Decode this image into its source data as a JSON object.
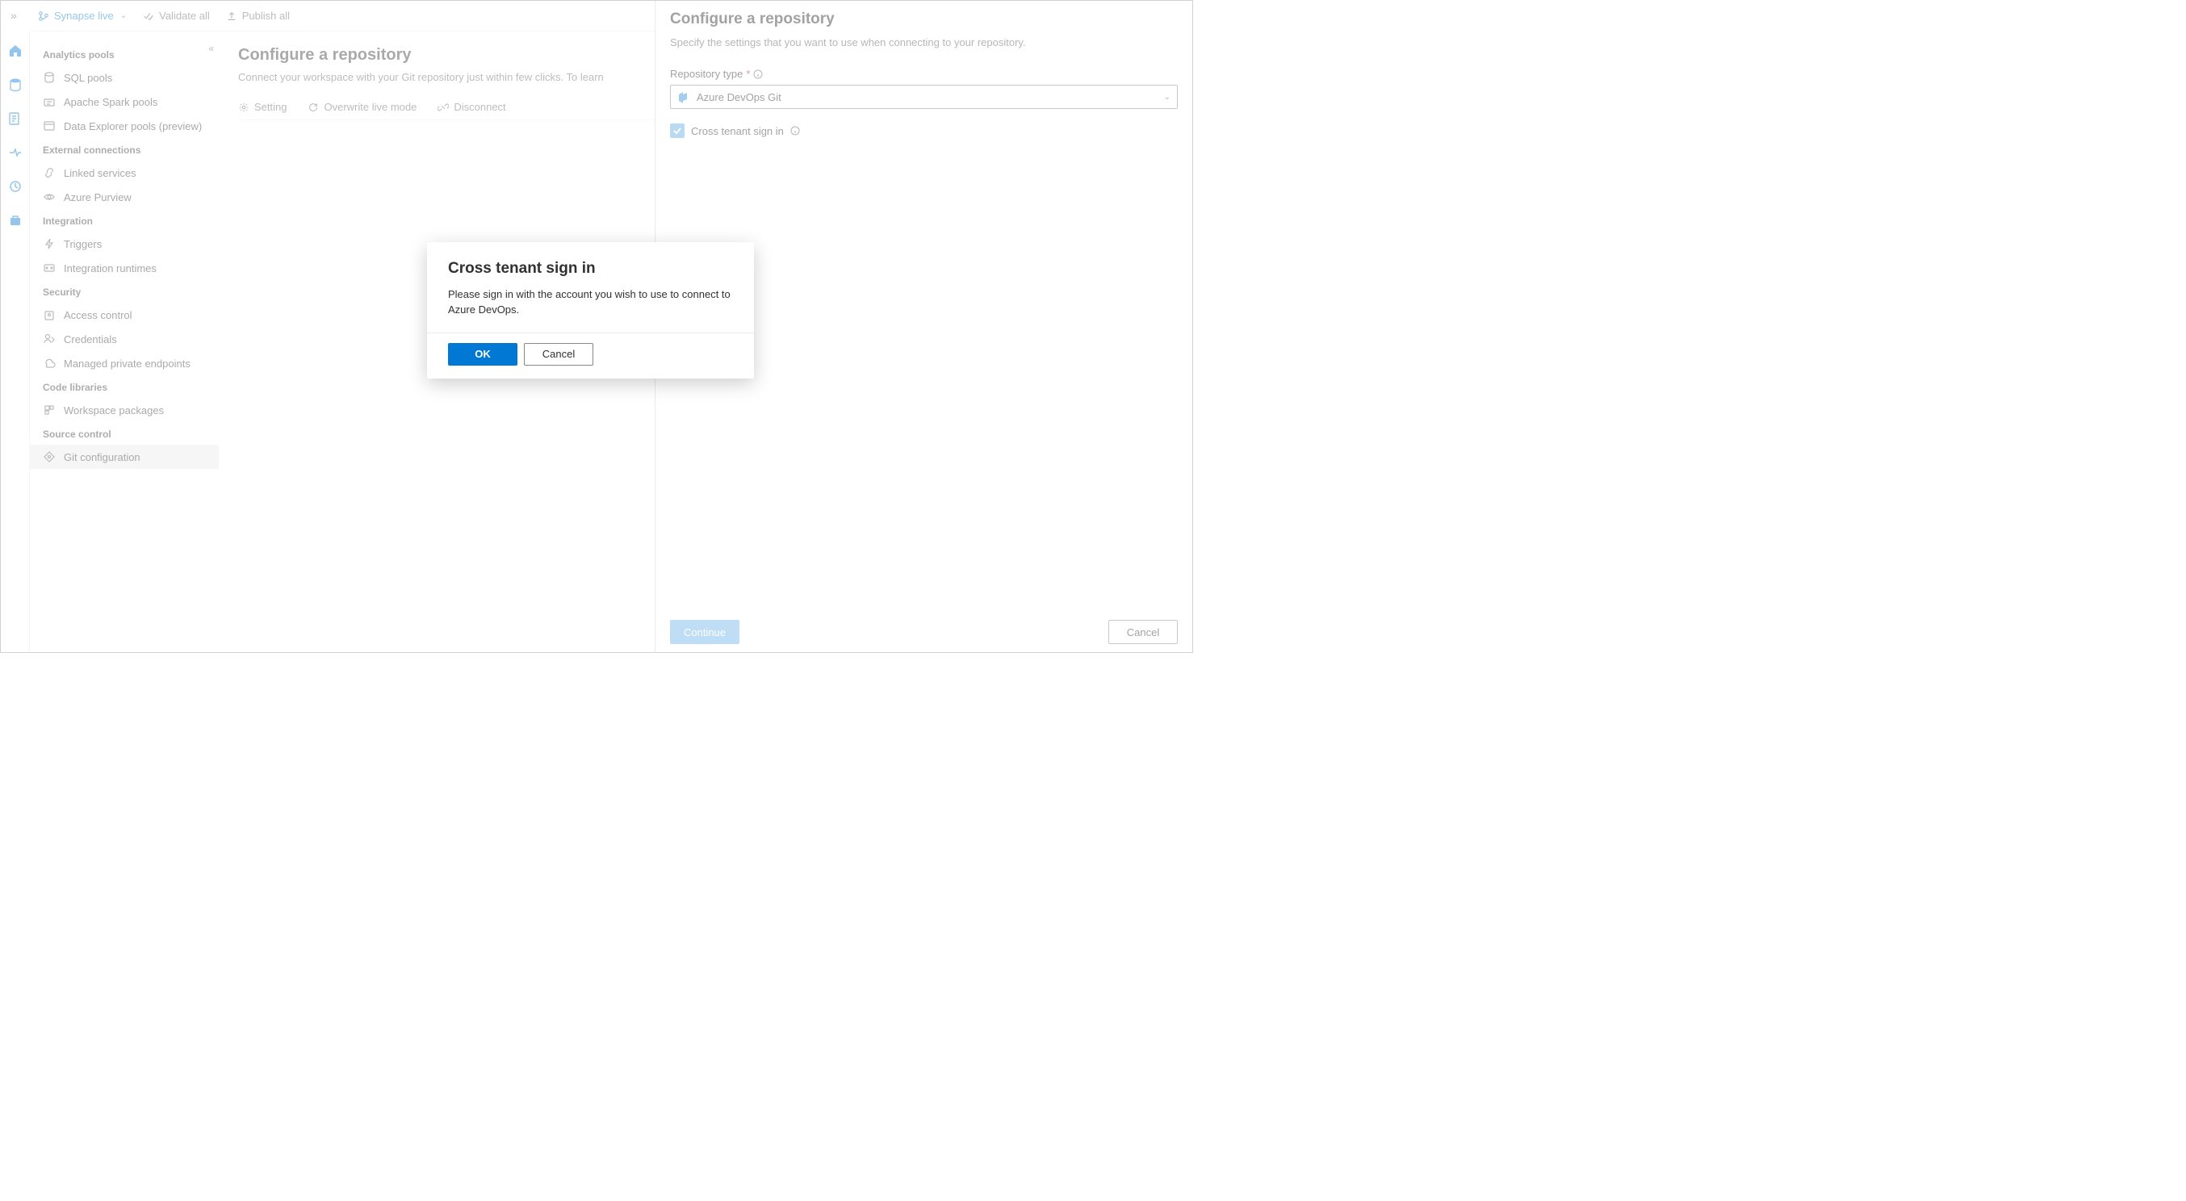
{
  "toolbar": {
    "mode_label": "Synapse live",
    "validate_label": "Validate all",
    "publish_label": "Publish all"
  },
  "sidebar": {
    "sections": [
      {
        "header": "Analytics pools",
        "items": [
          "SQL pools",
          "Apache Spark pools",
          "Data Explorer pools (preview)"
        ]
      },
      {
        "header": "External connections",
        "items": [
          "Linked services",
          "Azure Purview"
        ]
      },
      {
        "header": "Integration",
        "items": [
          "Triggers",
          "Integration runtimes"
        ]
      },
      {
        "header": "Security",
        "items": [
          "Access control",
          "Credentials",
          "Managed private endpoints"
        ]
      },
      {
        "header": "Code libraries",
        "items": [
          "Workspace packages"
        ]
      },
      {
        "header": "Source control",
        "items": [
          "Git configuration"
        ]
      }
    ]
  },
  "main": {
    "title": "Configure a repository",
    "subtitle": "Connect your workspace with your Git repository just within few clicks. To learn",
    "tabs": [
      "Setting",
      "Overwrite live mode",
      "Disconnect"
    ]
  },
  "panel": {
    "title": "Configure a repository",
    "description": "Specify the settings that you want to use when connecting to your repository.",
    "repo_type_label": "Repository type",
    "repo_type_value": "Azure DevOps Git",
    "checkbox_label": "Cross tenant sign in",
    "continue_label": "Continue",
    "cancel_label": "Cancel"
  },
  "modal": {
    "title": "Cross tenant sign in",
    "text": "Please sign in with the account you wish to use to connect to Azure DevOps.",
    "ok_label": "OK",
    "cancel_label": "Cancel"
  }
}
